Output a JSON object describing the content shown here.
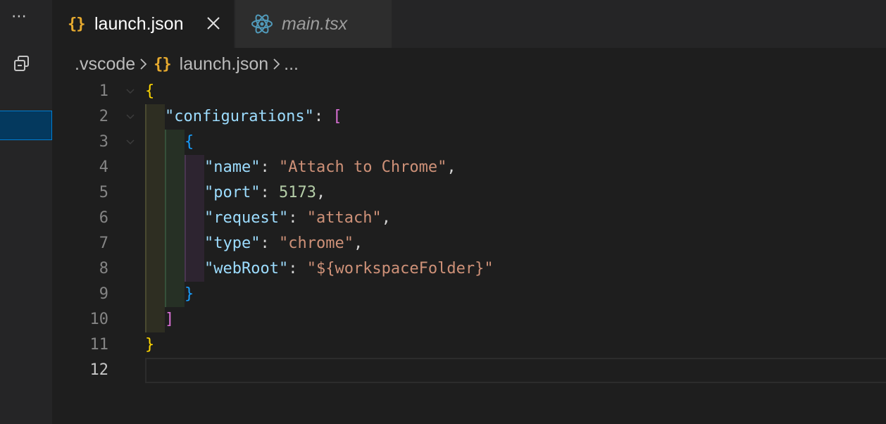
{
  "activity": {
    "more_label": "⋯"
  },
  "tabs": [
    {
      "label": "launch.json",
      "icon": "json-braces-icon",
      "active": true
    },
    {
      "label": "main.tsx",
      "icon": "react-icon",
      "active": false
    }
  ],
  "breadcrumb": {
    "folder": ".vscode",
    "file": "launch.json",
    "ellipsis": "..."
  },
  "braces_glyph": "{}",
  "editor": {
    "current_line": 12,
    "line_numbers": [
      "1",
      "2",
      "3",
      "4",
      "5",
      "6",
      "7",
      "8",
      "9",
      "10",
      "11",
      "12"
    ],
    "lines": {
      "l1_open": "{",
      "l2_key": "\"configurations\"",
      "l2_colon": ": ",
      "l2_bracket": "[",
      "l3_open": "{",
      "l4_key": "\"name\"",
      "l4_value": "\"Attach to Chrome\"",
      "l5_key": "\"port\"",
      "l5_value": "5173",
      "l6_key": "\"request\"",
      "l6_value": "\"attach\"",
      "l7_key": "\"type\"",
      "l7_value": "\"chrome\"",
      "l8_key": "\"webRoot\"",
      "l8_value": "\"${workspaceFolder}\"",
      "l9_close": "}",
      "l10_close": "]",
      "l11_close": "}",
      "colon": ": ",
      "comma": ","
    }
  },
  "colors": {
    "key": "#9cdcfe",
    "string": "#ce9178",
    "number": "#b5cea8",
    "bracket_level1": "#ffd700",
    "bracket_level2": "#da70d6",
    "bracket_level3": "#179fff",
    "json_icon": "#e8ab2f",
    "react_icon": "#519aba"
  }
}
